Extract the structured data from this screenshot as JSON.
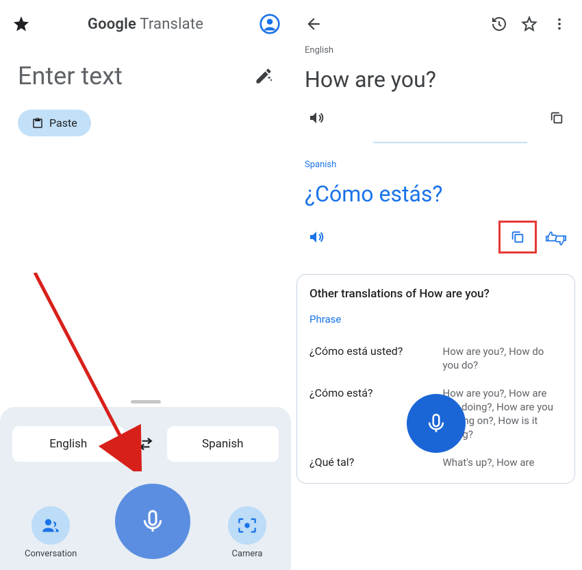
{
  "left": {
    "title_bold": "Google",
    "title_rest": "Translate",
    "enter_placeholder": "Enter text",
    "paste_label": "Paste",
    "lang_source": "English",
    "lang_target": "Spanish",
    "conversation_label": "Conversation",
    "camera_label": "Camera"
  },
  "right": {
    "src_label": "English",
    "src_text": "How are you?",
    "dst_label": "Spanish",
    "dst_text": "¿Cómo estás?",
    "card_title": "Other translations of How are you?",
    "phrase_label": "Phrase",
    "rows": [
      {
        "src": "¿Cómo está usted?",
        "dst": "How are you?, How do you do?"
      },
      {
        "src": "¿Cómo está?",
        "dst": "How are you?, How are you doing?, How are you getting on?, How is it going?"
      },
      {
        "src": "¿Qué tal?",
        "dst": "What's up?, How are"
      }
    ]
  }
}
